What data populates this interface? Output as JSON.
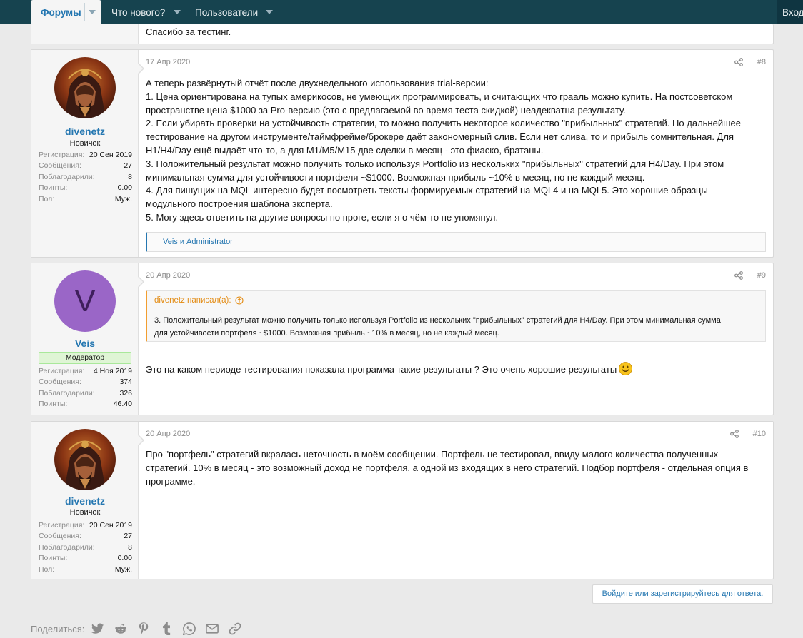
{
  "nav": {
    "forums": "Форумы",
    "whats_new": "Что нового?",
    "users": "Пользователи",
    "login": "Вход"
  },
  "prev_post": {
    "text": "Спасибо за тестинг."
  },
  "posts": [
    {
      "date": "17 Апр 2020",
      "num": "#8",
      "author": {
        "name": "divenetz",
        "title": "Новичок",
        "stats": [
          {
            "k": "Регистрация:",
            "v": "20 Сен 2019"
          },
          {
            "k": "Сообщения:",
            "v": "27"
          },
          {
            "k": "Поблагодарили:",
            "v": "8"
          },
          {
            "k": "Поинты:",
            "v": "0.00"
          },
          {
            "k": "Пол:",
            "v": "Муж."
          }
        ]
      },
      "lines": [
        "А теперь развёрнутый отчёт после двухнедельного использования trial-версии:",
        "1. Цена ориентирована на тупых америкосов, не умеющих программировать, и считающих что грааль можно купить. На постсоветском",
        "пространстве цена $1000 за Pro-версию (это с предлагаемой во время теста скидкой) неадекватна результату.",
        "2. Если убирать проверки на устойчивость стратегии, то можно получить некоторое количество \"прибыльных\" стратегий. Но дальнейшее",
        "тестирование на другом инструменте/таймфрейме/брокере даёт закономерный слив. Если нет слива, то и прибыль сомнительная. Для",
        "H1/H4/Day ещё выдаёт что-то, а для M1/M5/M15 две сделки в месяц - это фиаско, братаны.",
        "3. Положительный результат можно получить только используя Portfolio из нескольких \"прибыльных\" стратегий для H4/Day. При этом",
        "минимальная сумма для устойчивости портфеля ~$1000. Возможная прибыль ~10% в месяц, но не каждый месяц.",
        "4. Для пишущих на MQL интересно будет посмотреть тексты формируемых стратегий на MQL4 и на MQL5. Это хорошие образцы",
        "модульного построения шаблона эксперта.",
        "5. Могу здесь ответить на другие вопросы по проге, если я о чём-то не упомянул."
      ],
      "likes": "Veis и Administrator"
    },
    {
      "date": "20 Апр 2020",
      "num": "#9",
      "author": {
        "name": "Veis",
        "avatar_letter": "V",
        "badge": "Модератор",
        "stats": [
          {
            "k": "Регистрация:",
            "v": "4 Ноя 2019"
          },
          {
            "k": "Сообщения:",
            "v": "374"
          },
          {
            "k": "Поблагодарили:",
            "v": "326"
          },
          {
            "k": "Поинты:",
            "v": "46.40"
          }
        ]
      },
      "quote": {
        "author": "divenetz написал(а):",
        "lines": [
          "3. Положительный результат можно получить только используя Portfolio из нескольких \"прибыльных\" стратегий для H4/Day. При этом минимальная сумма",
          "для устойчивости портфеля ~$1000. Возможная прибыль ~10% в месяц, но не каждый месяц."
        ]
      },
      "text": "Это на каком периоде тестирования показала программа такие результаты ? Это очень хорошие результаты"
    },
    {
      "date": "20 Апр 2020",
      "num": "#10",
      "author": {
        "name": "divenetz",
        "title": "Новичок",
        "stats": [
          {
            "k": "Регистрация:",
            "v": "20 Сен 2019"
          },
          {
            "k": "Сообщения:",
            "v": "27"
          },
          {
            "k": "Поблагодарили:",
            "v": "8"
          },
          {
            "k": "Поинты:",
            "v": "0.00"
          },
          {
            "k": "Пол:",
            "v": "Муж."
          }
        ]
      },
      "lines": [
        "Про \"портфель\" стратегий вкралась неточность в моём сообщении. Портфель не тестировал, ввиду малого количества полученных",
        "стратегий. 10% в месяц - это возможный доход не портфеля, а одной из входящих в него стратегий. Подбор портфеля - отдельная опция в",
        "программе."
      ]
    }
  ],
  "reply_prompt": "Войдите или зарегистрируйтесь для ответа.",
  "share": {
    "label": "Поделиться:",
    "icons": [
      "twitter-icon",
      "reddit-icon",
      "pinterest-icon",
      "tumblr-icon",
      "whatsapp-icon",
      "email-icon",
      "link-icon"
    ]
  },
  "colors": {
    "nav_bg": "#16434f",
    "link": "#2577b1",
    "quote_accent": "#f29e30",
    "moderator_badge": "#dff5d5",
    "avatar_purple": "#9a66c7"
  }
}
